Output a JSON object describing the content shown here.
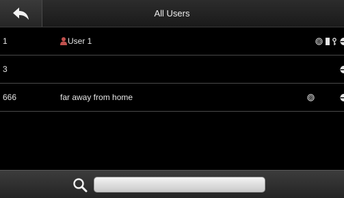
{
  "header": {
    "title": "All Users",
    "back_icon": "back-arrow-icon"
  },
  "users": [
    {
      "id": "1",
      "name": "User 1",
      "is_admin": true,
      "icons": [
        "face-icon",
        "card-icon",
        "password-icon",
        "fingerprint-icon"
      ]
    },
    {
      "id": "3",
      "name": "",
      "is_admin": false,
      "icons": [
        "fingerprint-icon"
      ]
    },
    {
      "id": "666",
      "name": "far away from home",
      "is_admin": false,
      "icons": [
        "face-icon",
        "fingerprint-icon"
      ]
    }
  ],
  "search": {
    "icon": "search-icon",
    "value": "",
    "placeholder": ""
  },
  "colors": {
    "background": "#000000",
    "admin_icon": "#c0504d",
    "row_divider": "#4a4a4a"
  }
}
